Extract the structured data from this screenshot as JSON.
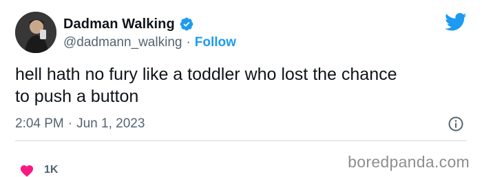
{
  "author": {
    "display_name": "Dadman Walking",
    "handle": "@dadmann_walking",
    "separator": "·",
    "follow_label": "Follow",
    "verified": true
  },
  "tweet": {
    "text": "hell hath no fury like a toddler who lost the chance\nto push a button",
    "time": "2:04 PM",
    "separator": "·",
    "date": "Jun 1, 2023"
  },
  "engagement": {
    "likes": "1K"
  },
  "watermark": "boredpanda.com",
  "colors": {
    "accent": "#1d9bf0",
    "heart": "#f91880",
    "secondary_text": "#536471",
    "divider": "#cfd9de"
  },
  "icons": {
    "verified": "verified-badge-icon",
    "brand": "twitter-bird-icon",
    "info": "info-icon",
    "like": "heart-icon"
  }
}
